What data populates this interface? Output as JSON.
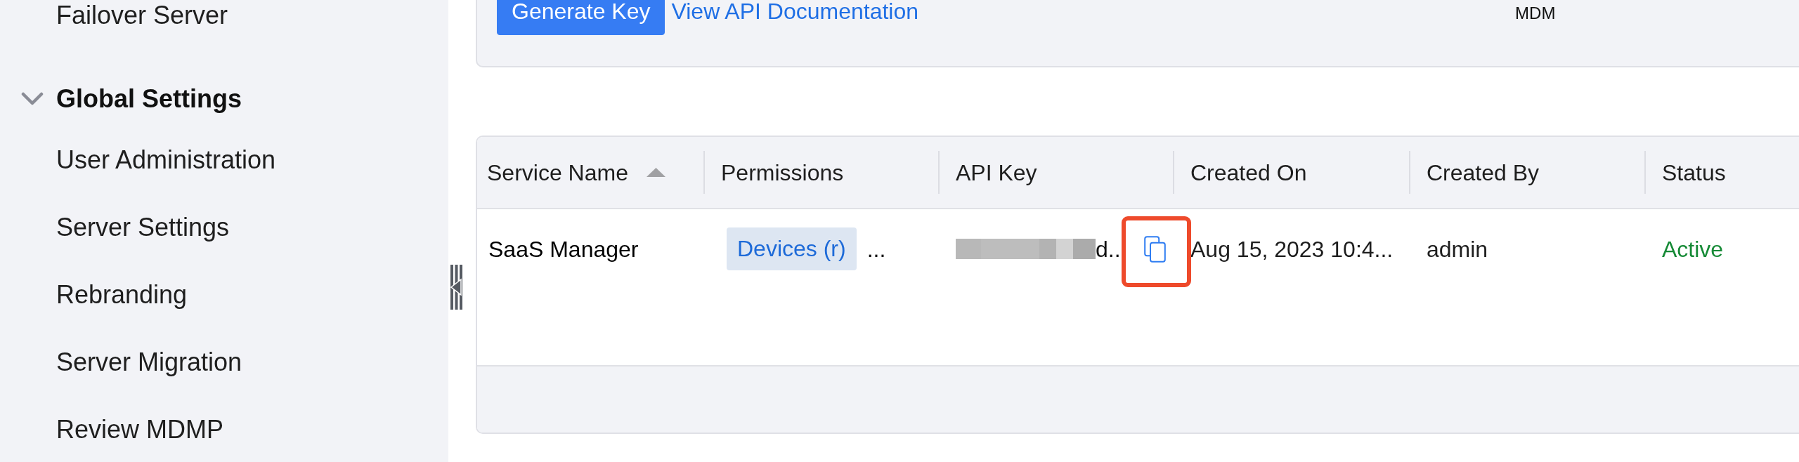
{
  "sidebar": {
    "sections": [
      {
        "items": [
          {
            "label": "Failover Server"
          }
        ]
      },
      {
        "title": "Global Settings",
        "expanded": true,
        "items": [
          {
            "label": "User Administration"
          },
          {
            "label": "Server Settings"
          },
          {
            "label": "Rebranding"
          },
          {
            "label": "Server Migration"
          },
          {
            "label": "Review MDMP"
          }
        ]
      }
    ]
  },
  "api_panel": {
    "button": "Generate Key",
    "link": "View API Documentation",
    "trailing_text": "MDM"
  },
  "table": {
    "columns": [
      {
        "label": "Service Name",
        "sorted": true,
        "ascending": true
      },
      {
        "label": "Permissions"
      },
      {
        "label": "API Key"
      },
      {
        "label": "Created On"
      },
      {
        "label": "Created By"
      },
      {
        "label": "Status"
      }
    ],
    "rows": [
      {
        "service_name": "SaaS Manager",
        "permissions": [
          "Devices (r)"
        ],
        "permissions_more": "...",
        "api_key": "d..",
        "copy_highlighted": true,
        "created_on": "Aug 15, 2023 10:4...",
        "created_by": "admin",
        "status": "Active"
      }
    ]
  }
}
